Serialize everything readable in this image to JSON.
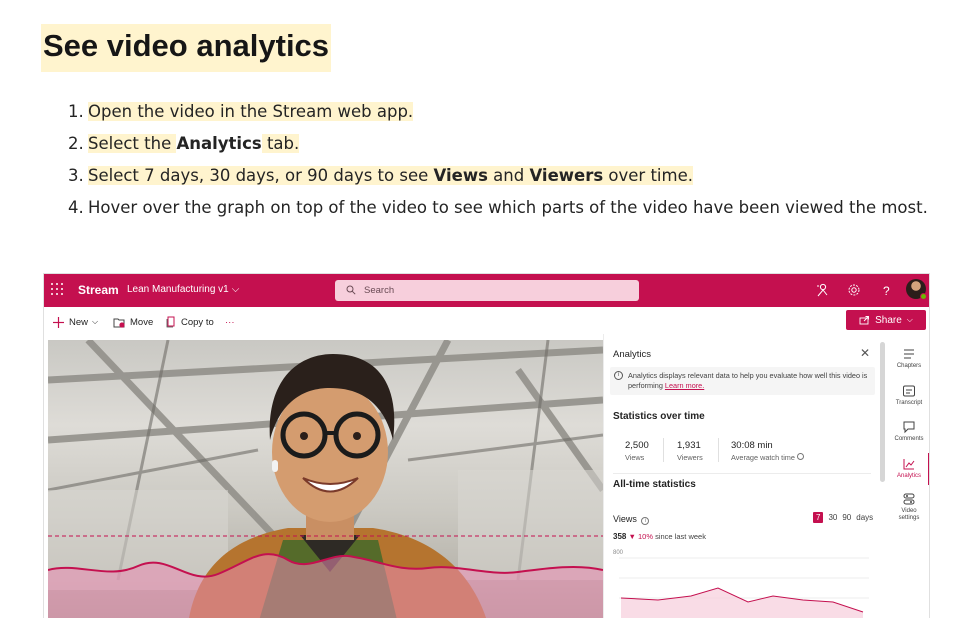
{
  "doc": {
    "title": "See video analytics",
    "steps": [
      {
        "num": "1.",
        "parts": [
          "Open the video in the Stream web app."
        ]
      },
      {
        "num": "2.",
        "pre": "Select the ",
        "bold": "Analytics",
        "post": " tab."
      },
      {
        "num": "3.",
        "pre": "Select 7 days, 30 days, or 90 days to see ",
        "bold1": "Views",
        "mid": " and ",
        "bold2": "Viewers",
        "post": " over time."
      },
      {
        "num": "4.",
        "text": "Hover over the graph on top of the video to see which parts of the video have been viewed the most."
      }
    ]
  },
  "app": {
    "name": "Stream",
    "video_name": "Lean Manufacturing v1",
    "search_placeholder": "Search",
    "commands": {
      "new": "New",
      "move": "Move",
      "copy_to": "Copy to",
      "more": "···"
    },
    "share": "Share",
    "analytics": {
      "title": "Analytics",
      "close": "✕",
      "info": "Analytics displays relevant data to help you evaluate how well this video is performing",
      "info_link": "Learn more.",
      "over_time_heading": "Statistics over time",
      "stats": [
        {
          "value": "2,500",
          "label": "Views"
        },
        {
          "value": "1,931",
          "label": "Viewers"
        },
        {
          "value": "30:08 min",
          "label": "Average watch time"
        }
      ],
      "all_time_heading": "All-time statistics",
      "views_label": "Views",
      "range": [
        "7",
        "30",
        "90",
        "days"
      ],
      "trend_value": "358",
      "trend_arrow": "▼",
      "trend_pct": "10%",
      "trend_text": "since last week",
      "chart_max": "800"
    },
    "rail": [
      {
        "label": "Chapters",
        "icon": "chapters-icon"
      },
      {
        "label": "Transcript",
        "icon": "transcript-icon"
      },
      {
        "label": "Comments",
        "icon": "comments-icon"
      },
      {
        "label": "Analytics",
        "icon": "analytics-icon"
      },
      {
        "label": "Video settings",
        "icon": "video-settings-icon"
      }
    ],
    "colors": {
      "brand": "#c4104f",
      "highlight": "#fff4ce"
    }
  }
}
